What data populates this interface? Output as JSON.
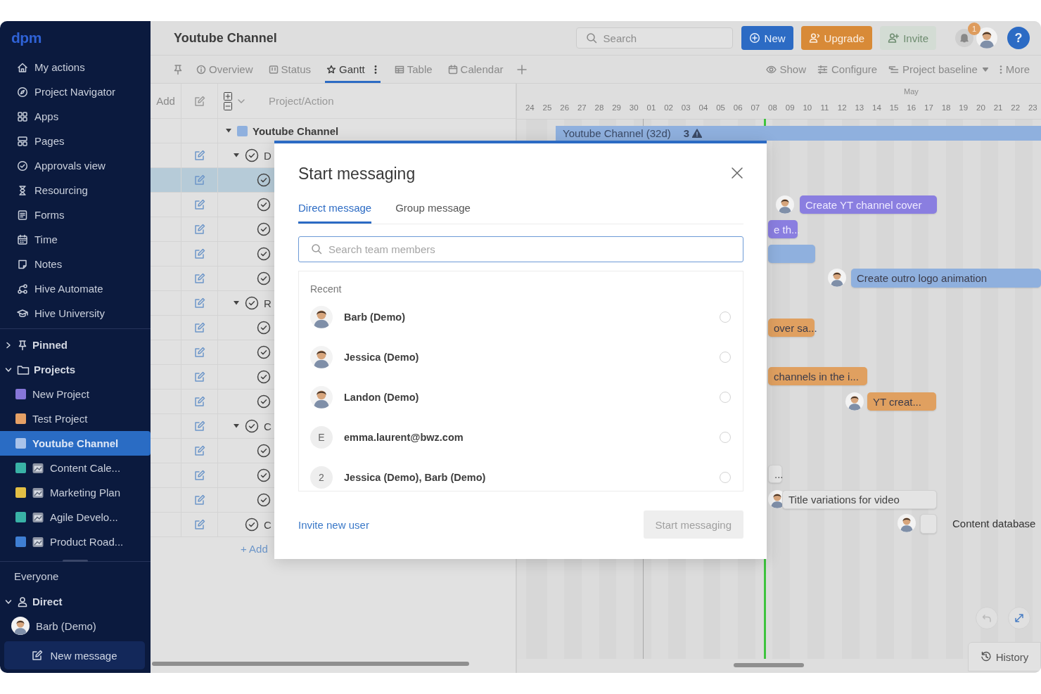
{
  "sidebar": {
    "logo": "dpm",
    "nav": [
      {
        "label": "My actions"
      },
      {
        "label": "Project Navigator"
      },
      {
        "label": "Apps"
      },
      {
        "label": "Pages"
      },
      {
        "label": "Approvals view"
      },
      {
        "label": "Resourcing"
      },
      {
        "label": "Forms"
      },
      {
        "label": "Time"
      },
      {
        "label": "Notes"
      },
      {
        "label": "Hive Automate"
      },
      {
        "label": "Hive University"
      }
    ],
    "pinned": {
      "label": "Pinned",
      "expanded": false
    },
    "projects": {
      "label": "Projects",
      "expanded": true,
      "items": [
        {
          "label": "New Project",
          "color": "#8676d8",
          "selected": false,
          "has_icon": false
        },
        {
          "label": "Test Project",
          "color": "#e5a066",
          "selected": false,
          "has_icon": false
        },
        {
          "label": "Youtube Channel",
          "color": "#a9c3ea",
          "selected": true,
          "has_icon": false
        },
        {
          "label": "Content Cale...",
          "color": "#39b2a6",
          "selected": false,
          "has_icon": true
        },
        {
          "label": "Marketing Plan",
          "color": "#e2bf45",
          "selected": false,
          "has_icon": true
        },
        {
          "label": "Agile Develo...",
          "color": "#39b2a6",
          "selected": false,
          "has_icon": true
        },
        {
          "label": "Product Road...",
          "color": "#3f7fd3",
          "selected": false,
          "has_icon": true
        }
      ]
    },
    "everyone": "Everyone",
    "direct": {
      "label": "Direct",
      "expanded": true,
      "people": [
        {
          "name": "Barb (Demo)"
        }
      ]
    },
    "new_message": "New message"
  },
  "header": {
    "title": "Youtube Channel",
    "search_placeholder": "Search",
    "buttons": [
      {
        "label": "New",
        "kind": "new"
      },
      {
        "label": "Upgrade",
        "kind": "upgrade"
      },
      {
        "label": "Invite",
        "kind": "invite"
      }
    ],
    "notifications": "1",
    "help": "?"
  },
  "views": {
    "tabs": [
      {
        "label": "Overview",
        "selected": false
      },
      {
        "label": "Status",
        "selected": false
      },
      {
        "label": "Gantt",
        "selected": true
      },
      {
        "label": "Table",
        "selected": false
      },
      {
        "label": "Calendar",
        "selected": false
      }
    ],
    "actions": [
      {
        "label": "Show"
      },
      {
        "label": "Configure"
      },
      {
        "label": "Project baseline"
      },
      {
        "label": "More"
      }
    ]
  },
  "table": {
    "add_column": "Add",
    "title_column": "Project/Action",
    "project": {
      "label": "Youtube Channel",
      "expanded": true
    },
    "rows": [
      {
        "kind": "group",
        "title": "D",
        "expanded": true,
        "selected": false
      },
      {
        "kind": "task",
        "selected": true
      },
      {
        "kind": "task",
        "selected": false
      },
      {
        "kind": "task",
        "selected": false
      },
      {
        "kind": "task",
        "selected": false
      },
      {
        "kind": "task",
        "selected": false
      },
      {
        "kind": "group",
        "title": "R",
        "expanded": true,
        "selected": false
      },
      {
        "kind": "task",
        "selected": false
      },
      {
        "kind": "task",
        "selected": false
      },
      {
        "kind": "task",
        "selected": false
      },
      {
        "kind": "task",
        "selected": false
      },
      {
        "kind": "group",
        "title": "C",
        "expanded": true,
        "selected": false
      },
      {
        "kind": "task",
        "selected": false
      },
      {
        "kind": "task",
        "selected": false
      },
      {
        "kind": "task",
        "selected": false
      },
      {
        "kind": "item",
        "title": "C",
        "selected": false
      }
    ],
    "add_link": "+ Add"
  },
  "gantt": {
    "month": "May",
    "days": [
      "24",
      "25",
      "26",
      "27",
      "28",
      "29",
      "30",
      "01",
      "02",
      "03",
      "04",
      "05",
      "06",
      "07",
      "08",
      "09",
      "10",
      "11",
      "12",
      "13",
      "14",
      "15",
      "16",
      "17",
      "18",
      "19",
      "20",
      "21",
      "22",
      "23"
    ],
    "summary": {
      "label": "Youtube Channel (32d)",
      "warnings": "3"
    },
    "bars": [
      {
        "kind": "bar",
        "label": "Create YT channel cover",
        "color": "#8a7ee0",
        "avatar": true
      },
      {
        "kind": "bar",
        "label": "e th...",
        "color": "#8a7ee0",
        "avatar": false
      },
      {
        "kind": "bar",
        "color": "#8fb0de",
        "avatar": false
      },
      {
        "kind": "bar",
        "label": "Create outro logo animation",
        "color": "#8fb0de",
        "avatar": true
      },
      {
        "kind": "bar",
        "label": "over sa...",
        "color": "#e0a060",
        "avatar": false
      },
      {
        "kind": "bar",
        "label": "channels in the i...",
        "color": "#e0a060",
        "avatar": false
      },
      {
        "kind": "bar",
        "label": "YT creat...",
        "color": "#e0a060",
        "avatar": true
      },
      {
        "kind": "bar",
        "label": "...",
        "color": "#e4e4e4",
        "avatar": false
      },
      {
        "kind": "bar",
        "label": "Title variations for video",
        "color": "#e4e4e4",
        "avatar": true
      },
      {
        "kind": "milestone",
        "label": "Content database",
        "color": "#e4e4e4",
        "avatar": true
      }
    ],
    "history": "History"
  },
  "dialog": {
    "title": "Start messaging",
    "tabs": [
      {
        "label": "Direct message",
        "selected": true
      },
      {
        "label": "Group message",
        "selected": false
      }
    ],
    "search_placeholder": "Search team members",
    "section": "Recent",
    "contacts": [
      {
        "name": "Barb (Demo)",
        "kind": "person",
        "selected": false
      },
      {
        "name": "Jessica (Demo)",
        "kind": "person",
        "selected": false
      },
      {
        "name": "Landon (Demo)",
        "kind": "person",
        "selected": false
      },
      {
        "name": "emma.laurent@bwz.com",
        "kind": "initial",
        "initial": "E",
        "selected": false
      },
      {
        "name": "Jessica (Demo), Barb (Demo)",
        "kind": "initial",
        "initial": "2",
        "selected": false
      }
    ],
    "invite_link": "Invite new user",
    "submit": {
      "label": "Start messaging",
      "disabled": true
    }
  }
}
